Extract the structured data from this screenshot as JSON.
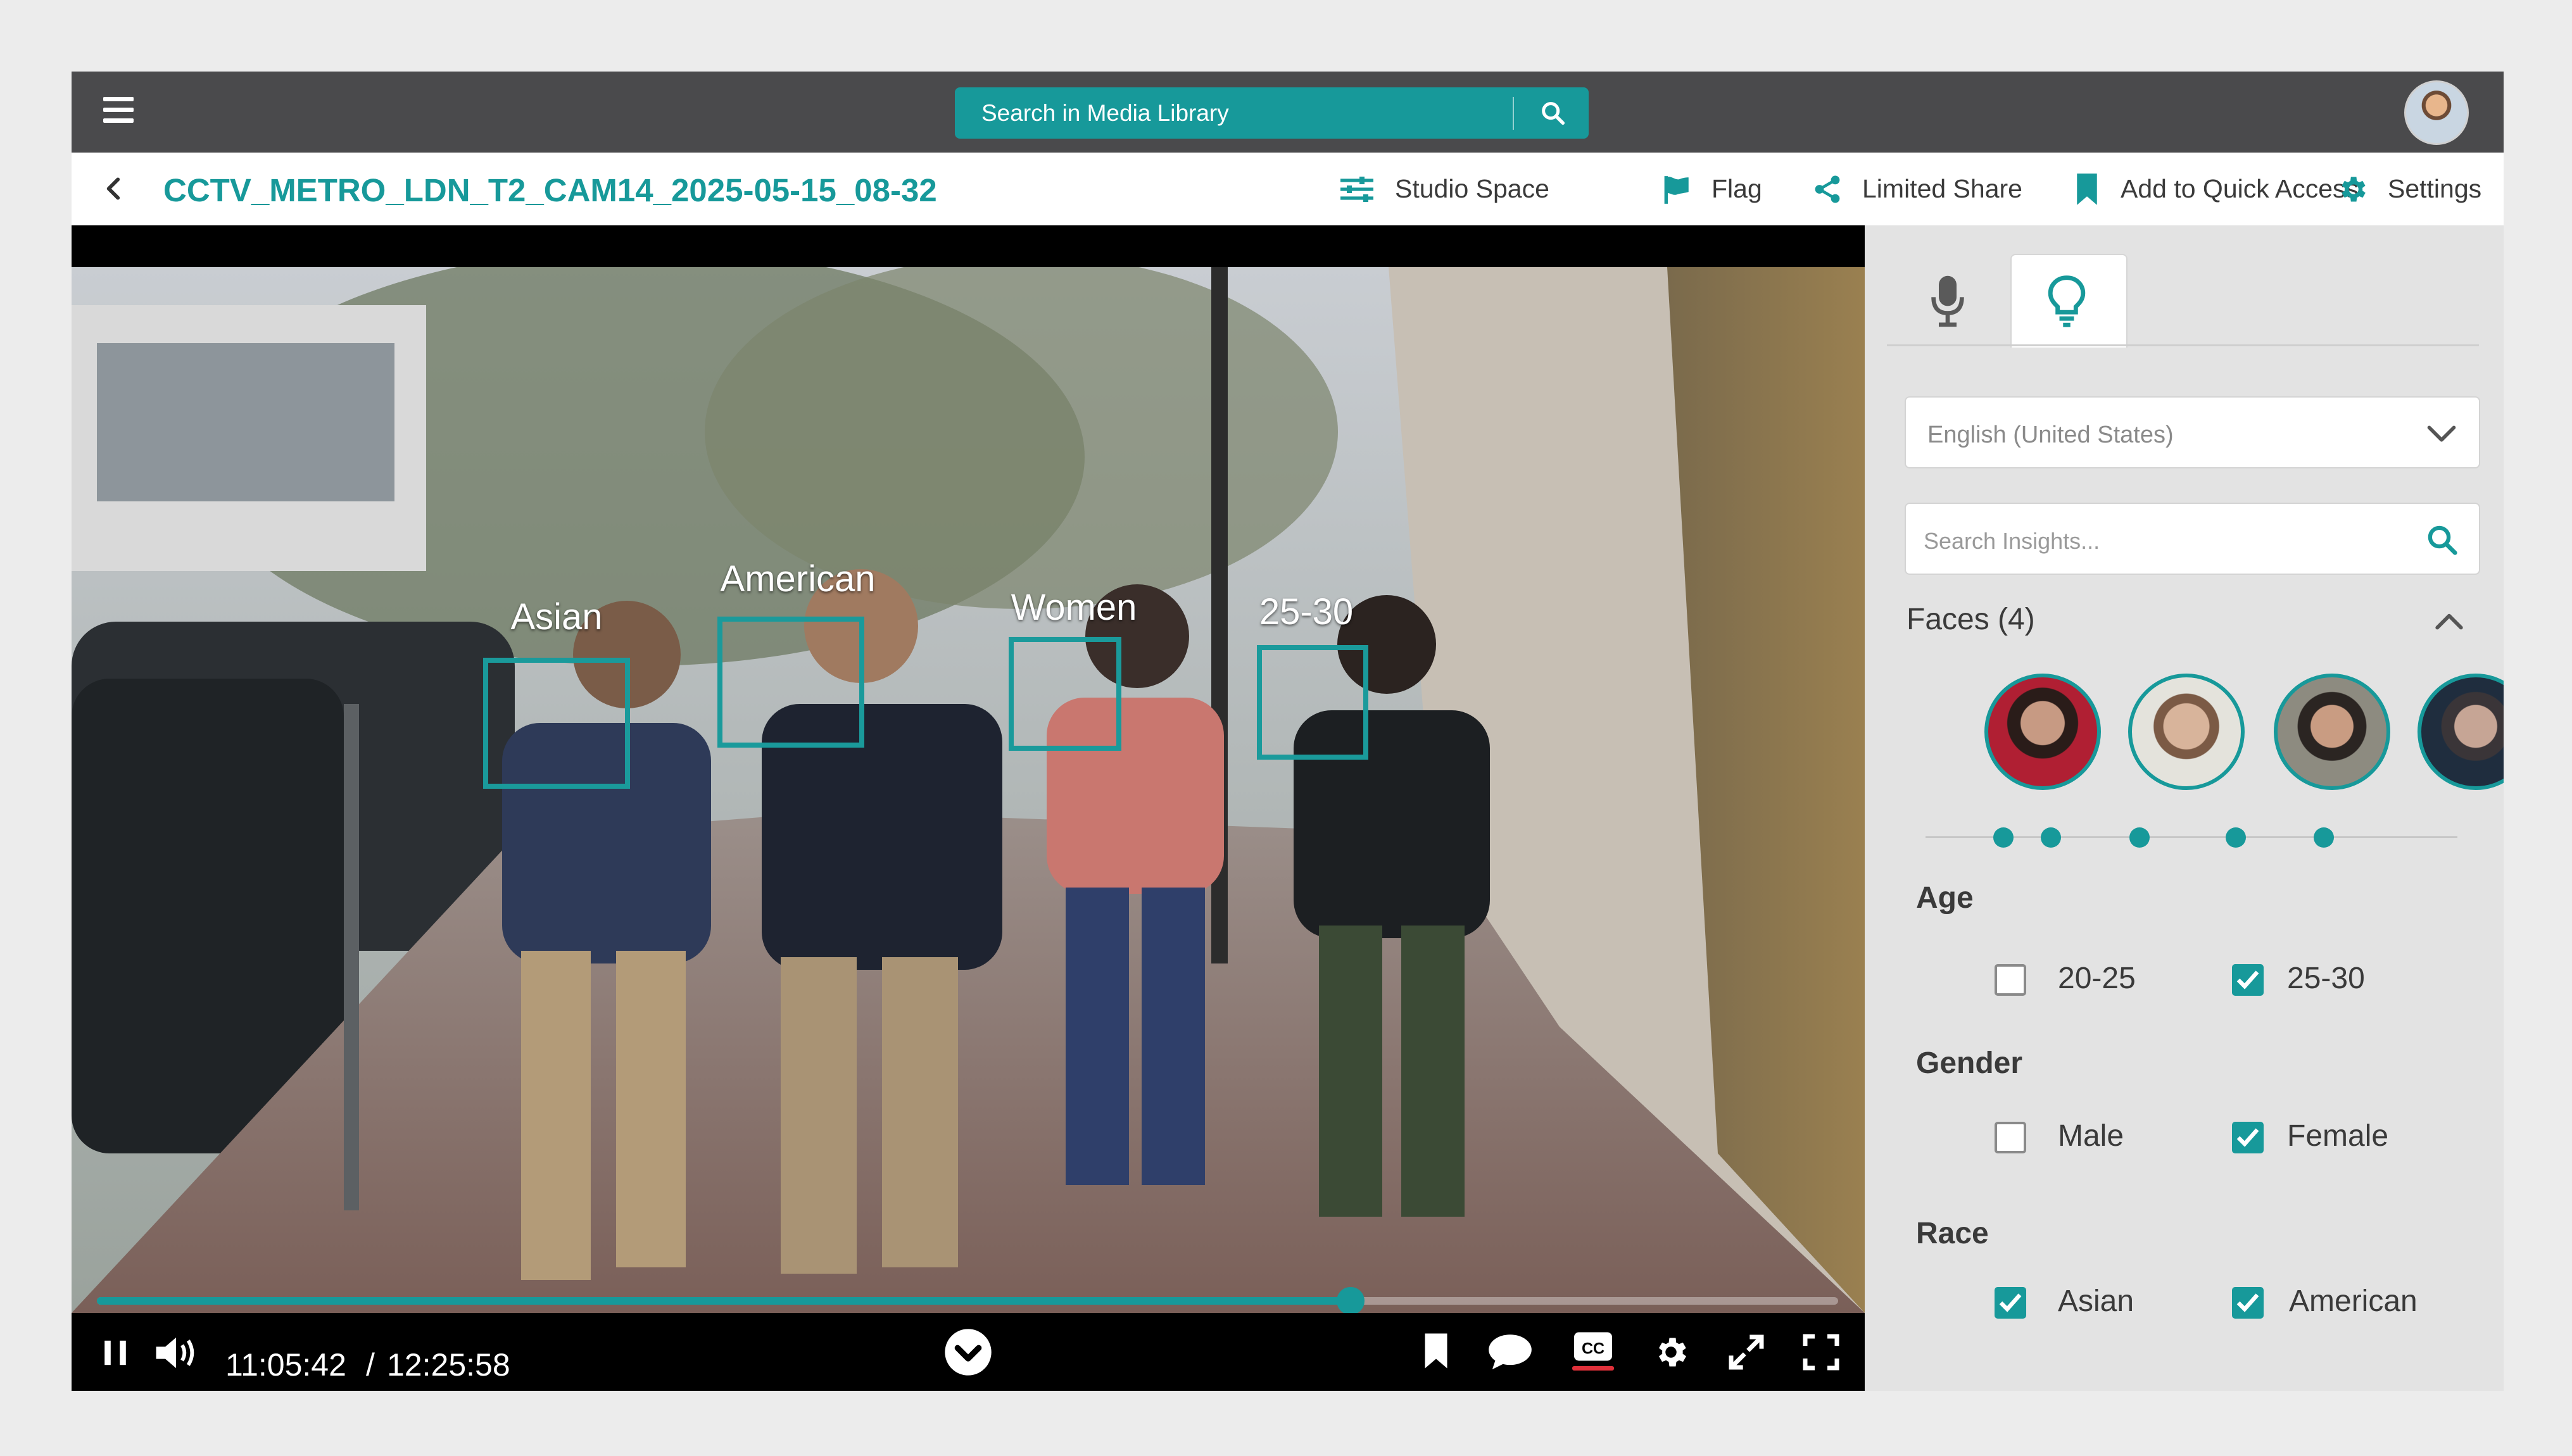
{
  "topbar": {
    "search_placeholder": "Search in Media Library"
  },
  "titlebar": {
    "file_name": "CCTV_METRO_LDN_T2_CAM14_2025-05-15_08-32",
    "actions": {
      "studio_space": "Studio Space",
      "flag": "Flag",
      "limited_share": "Limited Share",
      "quick_access": "Add to Quick Access",
      "settings": "Settings"
    }
  },
  "video": {
    "face_labels": [
      "Asian",
      "American",
      "Women",
      "25-30"
    ],
    "current_time": "11:05:42",
    "separator": "/",
    "total_time": "12:25:58",
    "progress": 0.72
  },
  "panel": {
    "language": "English (United States)",
    "search_placeholder": "Search Insights...",
    "faces_title": "Faces (4)",
    "age": {
      "title": "Age",
      "options": [
        {
          "label": "20-25",
          "checked": false
        },
        {
          "label": "25-30",
          "checked": true
        }
      ]
    },
    "gender": {
      "title": "Gender",
      "options": [
        {
          "label": "Male",
          "checked": false
        },
        {
          "label": "Female",
          "checked": true
        }
      ]
    },
    "race": {
      "title": "Race",
      "options": [
        {
          "label": "Asian",
          "checked": true
        },
        {
          "label": "American",
          "checked": true
        }
      ]
    }
  },
  "colors": {
    "accent": "#17999a",
    "topbar": "#4a4a4c"
  }
}
